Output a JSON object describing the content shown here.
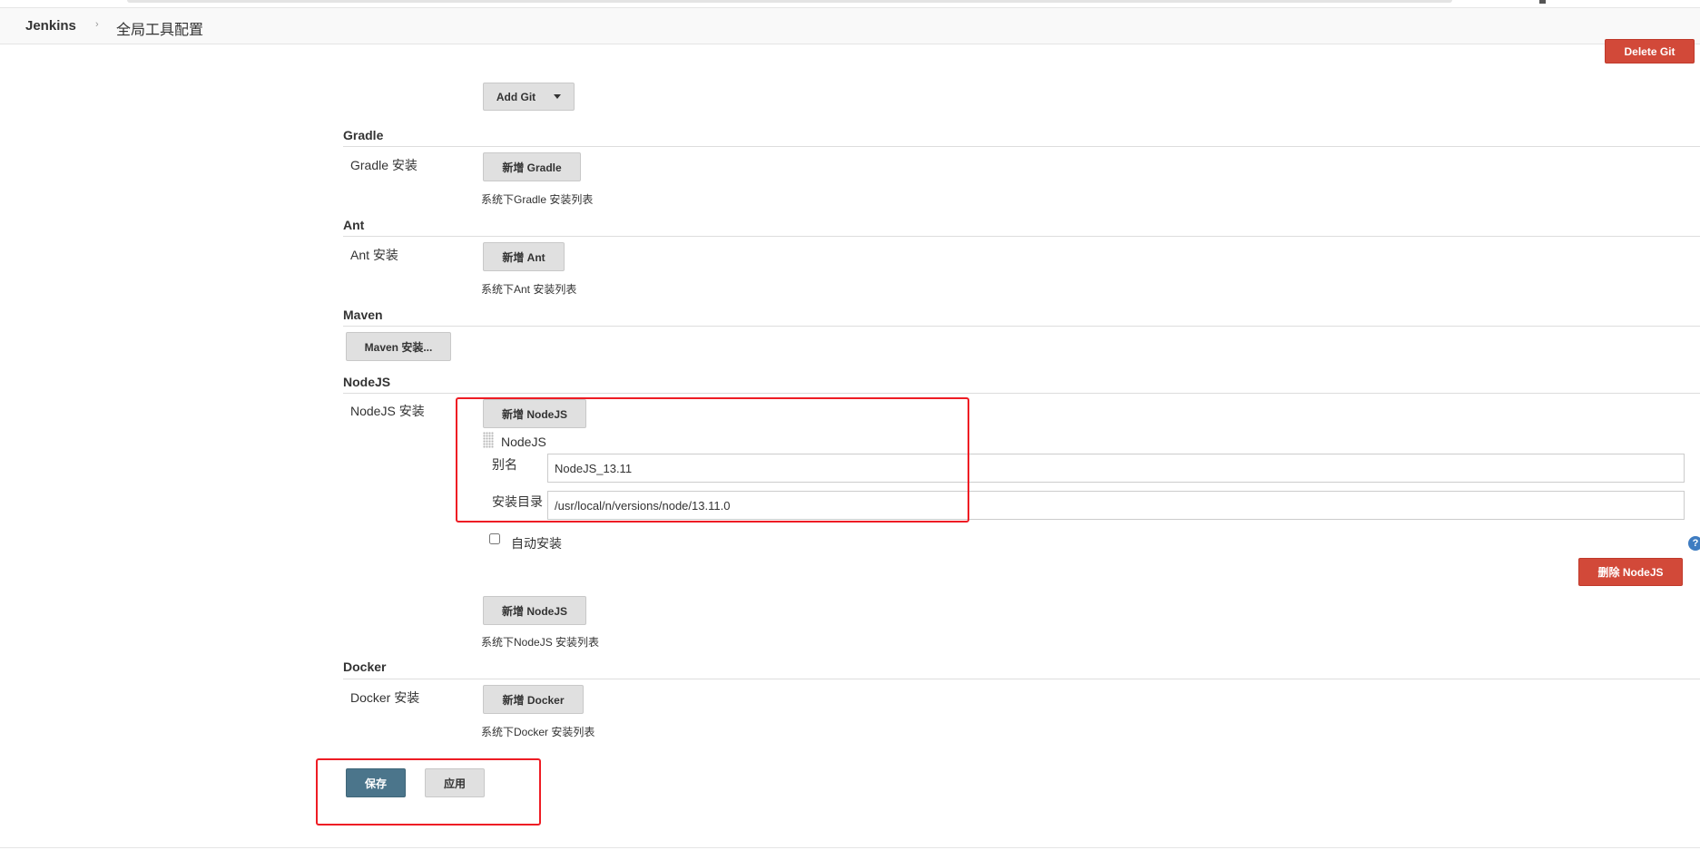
{
  "breadcrumb": {
    "home": "Jenkins",
    "separator": "›",
    "page": "全局工具配置"
  },
  "git": {
    "delete_label": "Delete Git",
    "add_label": "Add Git"
  },
  "gradle": {
    "title": "Gradle",
    "row_label": "Gradle 安装",
    "add_label": "新增 Gradle",
    "help": "系统下Gradle 安装列表"
  },
  "ant": {
    "title": "Ant",
    "row_label": "Ant 安装",
    "add_label": "新增 Ant",
    "help": "系统下Ant 安装列表"
  },
  "maven": {
    "title": "Maven",
    "button_label": "Maven 安装..."
  },
  "nodejs": {
    "title": "NodeJS",
    "row_label": "NodeJS 安装",
    "add_label": "新增 NodeJS",
    "entry_header": "NodeJS",
    "alias_label": "别名",
    "alias_value": "NodeJS_13.11",
    "dir_label": "安装目录",
    "dir_value": "/usr/local/n/versions/node/13.11.0",
    "auto_install_label": "自动安装",
    "auto_install_checked": false,
    "delete_label": "删除 NodeJS",
    "add_label_bottom": "新增 NodeJS",
    "help": "系统下NodeJS 安装列表"
  },
  "docker": {
    "title": "Docker",
    "row_label": "Docker 安装",
    "add_label": "新增 Docker",
    "help": "系统下Docker 安装列表"
  },
  "footer": {
    "save_label": "保存",
    "apply_label": "应用"
  },
  "icons": {
    "help": "question-mark-icon",
    "drag": "drag-handle-icon",
    "dropdown": "caret-down-icon"
  },
  "colors": {
    "delete_button": "#d24939",
    "save_button": "#4b758b",
    "highlight": "#ee1c24"
  }
}
